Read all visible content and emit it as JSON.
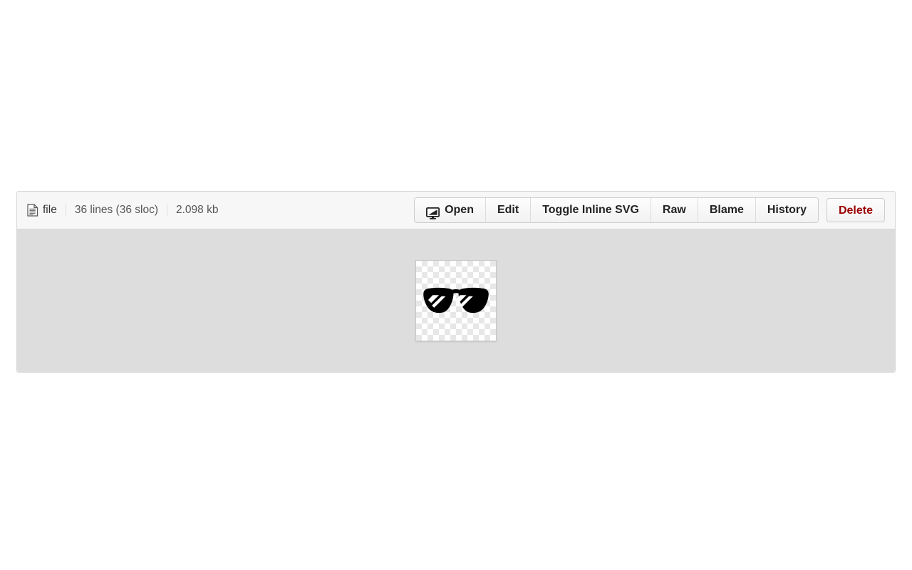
{
  "panel": {
    "meta": {
      "file_icon_name": "document-icon",
      "file_label": "file",
      "lines_label": "36 lines (36 sloc)",
      "size_label": "2.098 kb"
    },
    "toolbar": {
      "open_label": "Open",
      "open_icon_name": "monitor-icon",
      "edit_label": "Edit",
      "toggle_inline_svg_label": "Toggle Inline SVG",
      "raw_label": "Raw",
      "blame_label": "Blame",
      "history_label": "History",
      "delete_label": "Delete",
      "delete_color": "#9a0000"
    },
    "preview": {
      "image_name": "sunglasses-svg",
      "background_color": "#dddddd",
      "checkerboard_colors": [
        "#ffffff",
        "#e7e7e7"
      ],
      "artwork_color": "#000000",
      "highlight_color": "#ffffff"
    }
  }
}
